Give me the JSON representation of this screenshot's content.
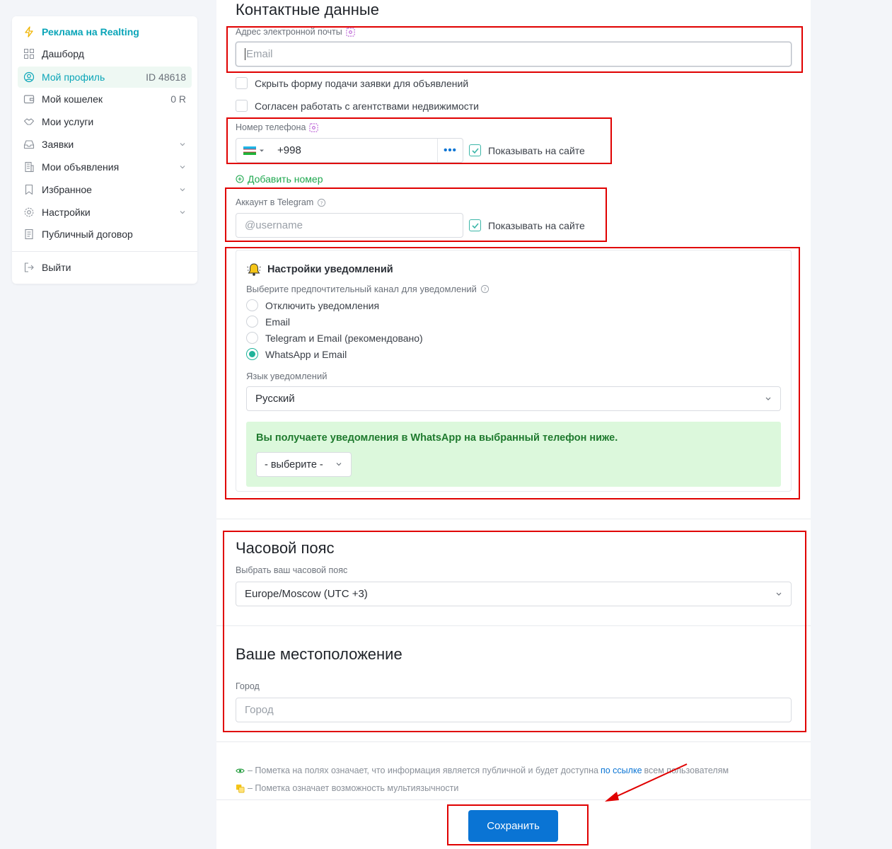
{
  "sidebar": {
    "items": [
      {
        "label": "Реклама на Realting",
        "icon": "lightning-icon"
      },
      {
        "label": "Дашборд",
        "icon": "dashboard-icon"
      },
      {
        "label": "Мой профиль",
        "icon": "user-circle-icon",
        "right": "ID 48618"
      },
      {
        "label": "Мой кошелек",
        "icon": "wallet-icon",
        "right": "0 R"
      },
      {
        "label": "Мои услуги",
        "icon": "handshake-icon"
      },
      {
        "label": "Заявки",
        "icon": "inbox-icon"
      },
      {
        "label": "Мои объявления",
        "icon": "building-icon"
      },
      {
        "label": "Избранное",
        "icon": "bookmark-icon"
      },
      {
        "label": "Настройки",
        "icon": "gear-icon"
      },
      {
        "label": "Публичный договор",
        "icon": "document-icon"
      }
    ],
    "logout": "Выйти"
  },
  "contacts": {
    "title": "Контактные данные",
    "email_label": "Адрес электронной почты",
    "email_placeholder": "Email",
    "hide_form": "Скрыть форму подачи заявки для объявлений",
    "agree_agencies": "Согласен работать с агентствами недвижимости",
    "phone_label": "Номер телефона",
    "phone_value": "+998",
    "show_on_site": "Показывать на сайте",
    "add_number": "Добавить номер",
    "telegram_label": "Аккаунт в Telegram",
    "telegram_placeholder": "@username"
  },
  "notifications": {
    "title": "Настройки уведомлений",
    "channel_label": "Выберите предпочтительный канал для уведомлений",
    "options": [
      "Отключить уведомления",
      "Email",
      "Telegram и Email (рекомендовано)",
      "WhatsApp и Email"
    ],
    "selected_index": 3,
    "lang_label": "Язык уведомлений",
    "lang_value": "Русский",
    "whatsapp_note": "Вы получаете уведомления в WhatsApp на выбранный телефон ниже.",
    "phone_select": "- выберите -"
  },
  "timezone": {
    "title": "Часовой пояс",
    "label": "Выбрать ваш часовой пояс",
    "value": "Europe/Moscow (UTC +3)"
  },
  "location": {
    "title": "Ваше местоположение",
    "city_label": "Город",
    "city_placeholder": "Город"
  },
  "footer": {
    "public_note_pre": "– Пометка на полях означает, что информация является публичной и будет доступна ",
    "public_note_link": "по ссылке",
    "public_note_post": " всем пользователям",
    "multilang_note": "– Пометка означает возможность мультиязычности",
    "save": "Сохранить"
  },
  "colors": {
    "accent": "#0aa5b8",
    "save_button": "#0a74d4",
    "annotation_red": "#e00000",
    "whatsapp_bg": "#dcf8dc"
  }
}
